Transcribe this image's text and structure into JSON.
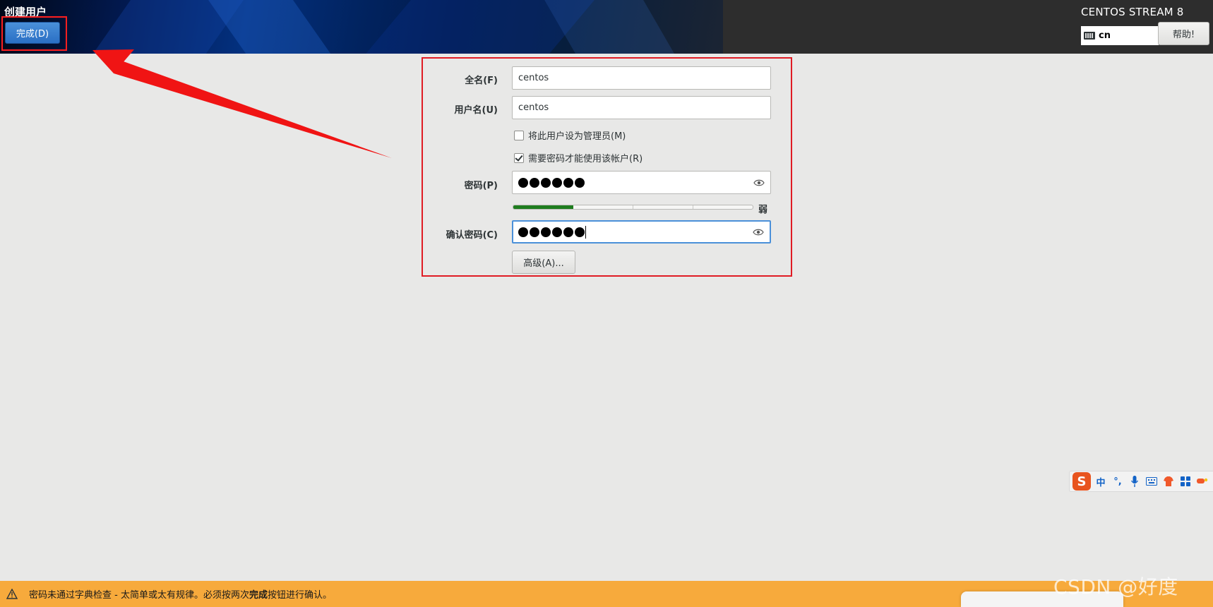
{
  "header": {
    "spoke_title": "创建用户",
    "done_button": "完成(D)",
    "product_title": "CENTOS STREAM 8",
    "keyboard_layout": "cn",
    "help_button": "帮助!"
  },
  "form": {
    "fullname_label": "全名(F)",
    "fullname_value": "centos",
    "username_label": "用户名(U)",
    "username_value": "centos",
    "admin_checkbox": {
      "label": "将此用户设为管理员(M)",
      "checked": false
    },
    "require_password_checkbox": {
      "label": "需要密码才能使用该帐户(R)",
      "checked": true
    },
    "password_label": "密码(P)",
    "password_length": 6,
    "strength_fraction": 0.25,
    "strength_label": "弱",
    "confirm_label": "确认密码(C)",
    "confirm_length": 6,
    "advanced_button": "高级(A)..."
  },
  "ime": {
    "logo": "S",
    "mode": "中",
    "punct": "°,",
    "icons": [
      "mic-icon",
      "keyboard-icon",
      "skin-icon",
      "grid-icon",
      "tools-icon"
    ]
  },
  "warning": {
    "prefix": "密码未通过字典检查 - 太简单或太有规律。必须按两次",
    "bold": "完成",
    "suffix": "按钮进行确认。"
  },
  "watermark": "CSDN @好度",
  "colors": {
    "accent": "#4a90d9",
    "warning": "#f7aa3c",
    "highlight": "#e01b24",
    "strength": "#1e7d1e"
  }
}
